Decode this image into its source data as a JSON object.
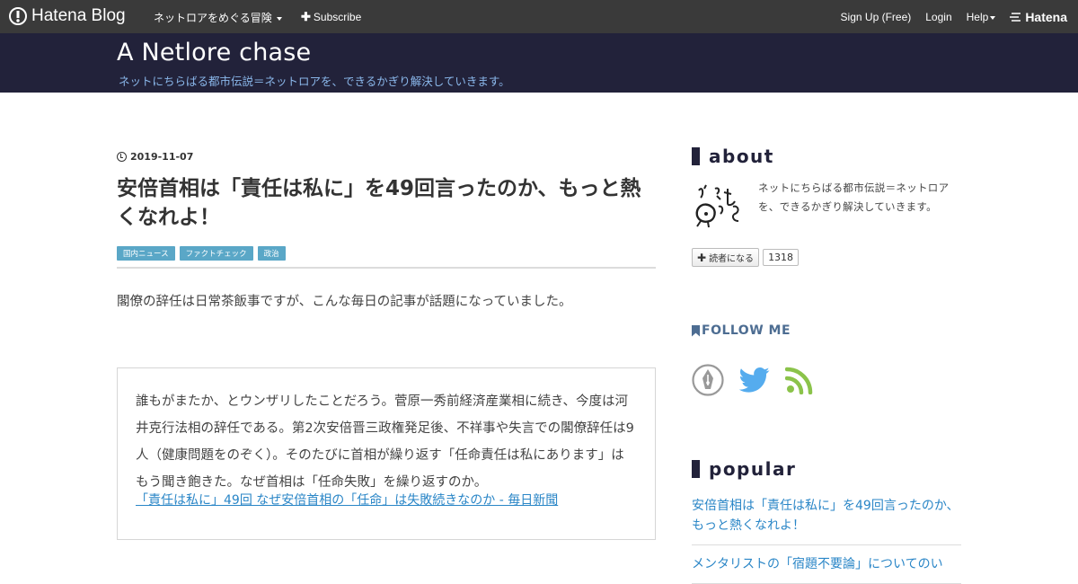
{
  "globalbar": {
    "logo_text": "Hatena Blog",
    "blog_menu": "ネットロアをめぐる冒険",
    "subscribe_label": "Subscribe",
    "signup_label": "Sign Up (Free)",
    "login_label": "Login",
    "help_label": "Help",
    "hatena_label": "Hatena"
  },
  "header": {
    "title": "A Netlore chase",
    "description": "ネットにちらばる都市伝説＝ネットロアを、できるかぎり解決していきます。"
  },
  "entry": {
    "date": "2019-11-07",
    "title": "安倍首相は「責任は私に」を49回言ったのか、もっと熱くなれよ！",
    "categories": [
      "国内ニュース",
      "ファクトチェック",
      "政治"
    ],
    "lead": "閣僚の辞任は日常茶飯事ですが、こんな毎日の記事が話題になっていました。",
    "quote": {
      "text": "誰もがまたか、とウンザリしたことだろう。菅原一秀前経済産業相に続き、今度は河井克行法相の辞任である。第2次安倍晋三政権発足後、不祥事や失言での閣僚辞任は9人（健康問題をのぞく）。そのたびに首相が繰り返す「任命責任は私にあります」はもう聞き飽きた。なぜ首相は「任命失敗」を繰り返すのか。",
      "link": "「責任は私に」49回 なぜ安倍首相の「任命」は失敗続きなのか - 毎日新聞"
    }
  },
  "sidebar": {
    "about": {
      "heading": "about",
      "text": "ネットにちらばる都市伝説＝ネットロアを、できるかぎり解決していきます。",
      "reader_button": "読者になる",
      "reader_count": "1318"
    },
    "follow": {
      "heading": "FOLLOW ME",
      "icons": [
        "hatena-pen-icon",
        "twitter-icon",
        "rss-icon"
      ]
    },
    "popular": {
      "heading": "popular",
      "items": [
        "安倍首相は「責任は私に」を49回言ったのか、もっと熱くなれよ！",
        "メンタリストの「宿題不要論」についてのい"
      ]
    }
  },
  "colors": {
    "globalbar": "#3a3a3a",
    "header_bg": "#22223a",
    "header_desc": "#8ab7ea",
    "category": "#5aa7c7",
    "link": "#2a86c7",
    "follow_heading": "#4d6d92",
    "twitter": "#55acee",
    "rss": "#8bc34a"
  }
}
